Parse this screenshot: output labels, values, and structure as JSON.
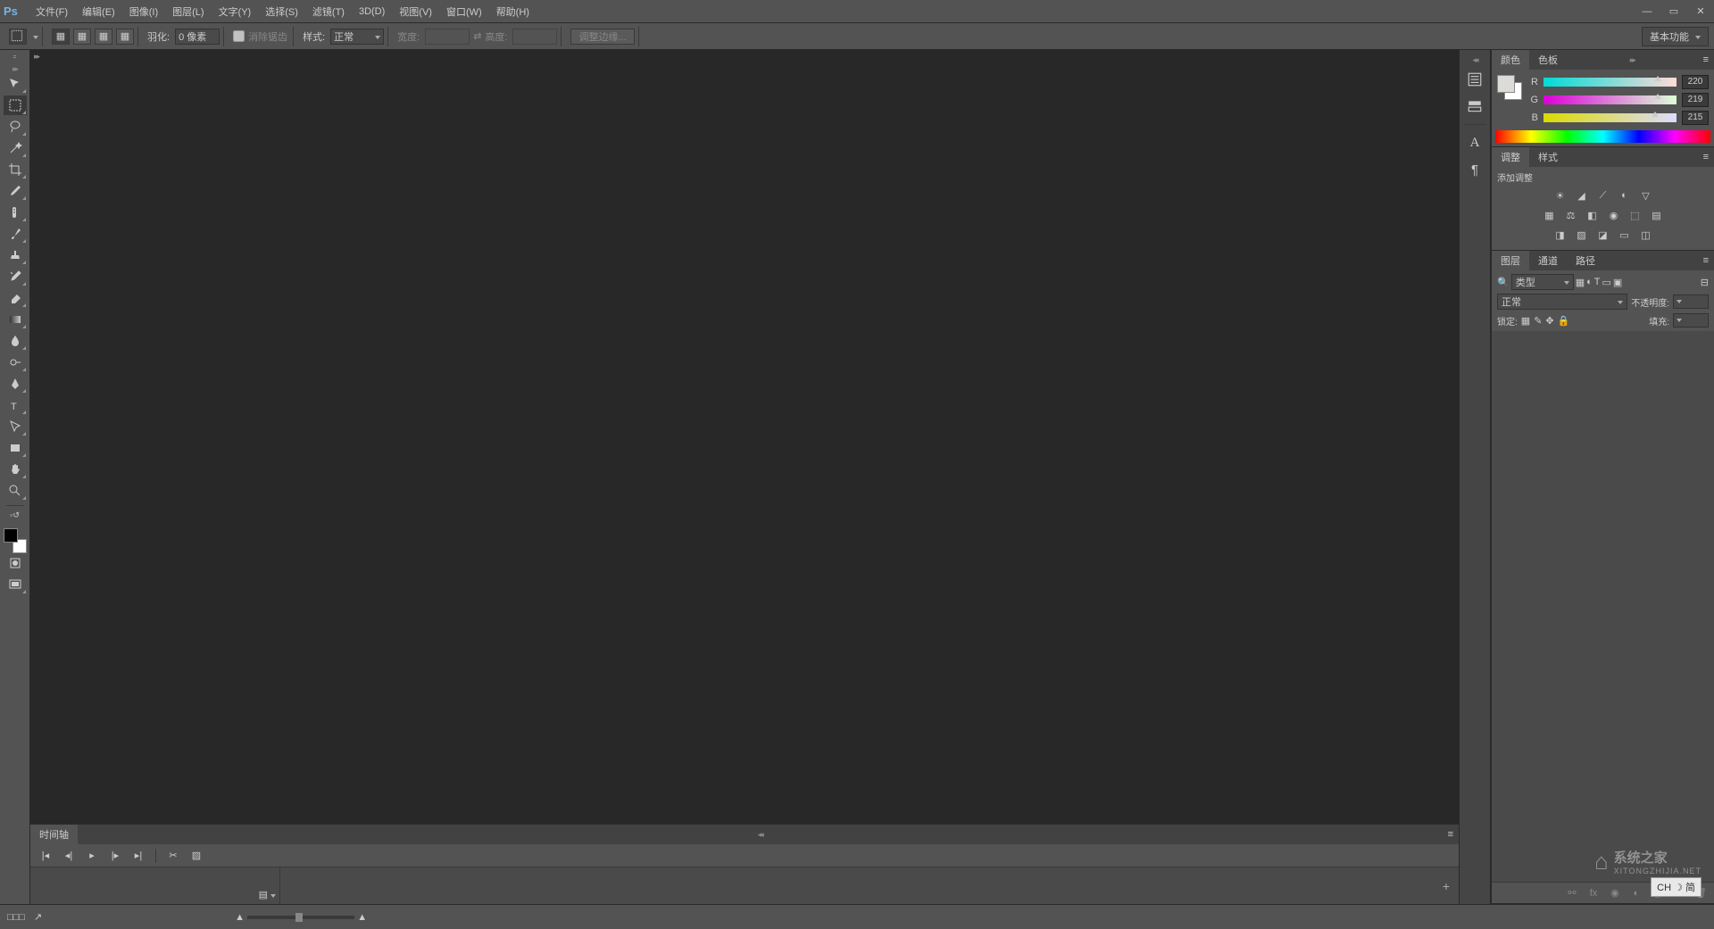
{
  "menu": {
    "file": "文件(F)",
    "edit": "编辑(E)",
    "image": "图像(I)",
    "layer": "图层(L)",
    "type": "文字(Y)",
    "select": "选择(S)",
    "filter": "滤镜(T)",
    "threeD": "3D(D)",
    "view": "视图(V)",
    "window": "窗口(W)",
    "help": "帮助(H)"
  },
  "options": {
    "feather_label": "羽化:",
    "feather_value": "0 像素",
    "antialias": "消除锯齿",
    "style_label": "样式:",
    "style_value": "正常",
    "width_label": "宽度:",
    "height_label": "高度:",
    "refine": "调整边缘...",
    "workspace": "基本功能"
  },
  "timeline": {
    "tab": "时间轴"
  },
  "panels": {
    "color_tab": "颜色",
    "swatch_tab": "色板",
    "adjust_tab": "调整",
    "styles_tab": "样式",
    "add_adjust": "添加调整",
    "layers_tab": "图层",
    "channels_tab": "通道",
    "paths_tab": "路径",
    "kind_label": "类型",
    "blend_value": "正常",
    "opacity_label": "不透明度:",
    "lock_label": "锁定:",
    "fill_label": "填充:"
  },
  "color": {
    "r_label": "R",
    "g_label": "G",
    "b_label": "B",
    "r": "220",
    "g": "219",
    "b": "215",
    "r_pct": 86,
    "g_pct": 86,
    "b_pct": 84
  },
  "ime": "CH ☽ 简",
  "watermark": {
    "name": "系统之家",
    "url": "XITONGZHIJIA.NET"
  },
  "status": {
    "left": "□□□"
  }
}
